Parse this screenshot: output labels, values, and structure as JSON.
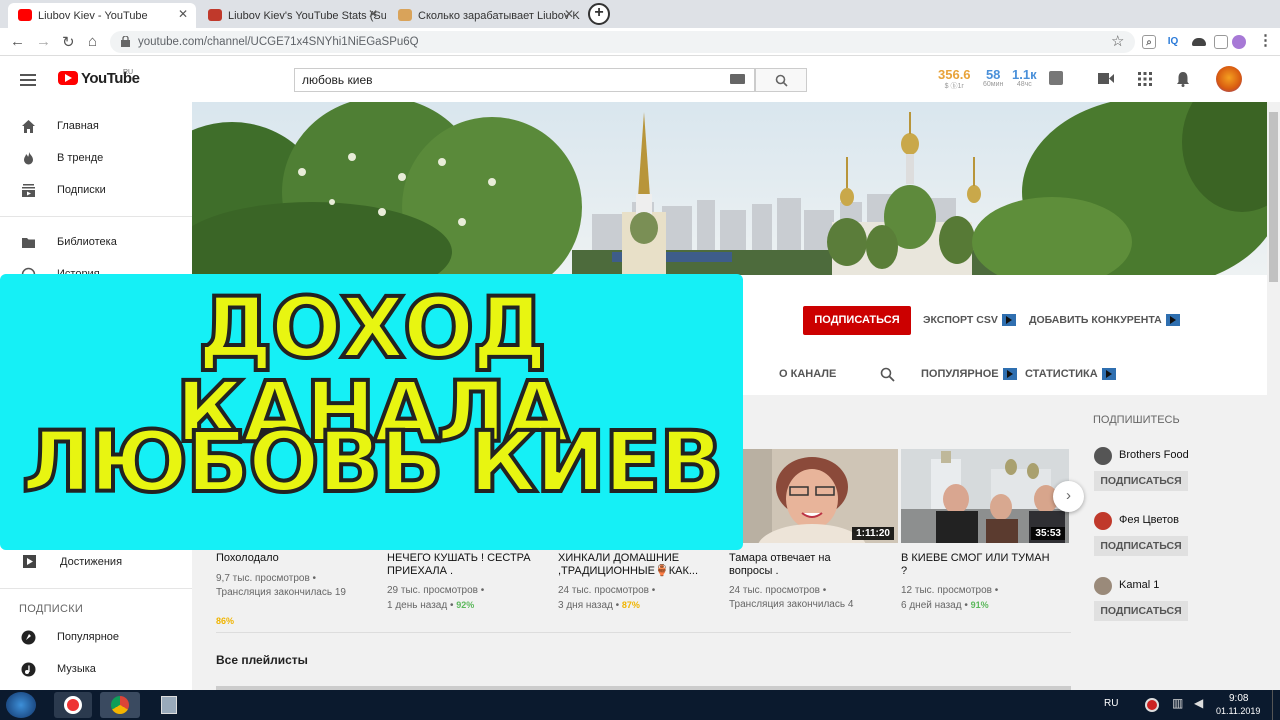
{
  "browser": {
    "tabs": [
      {
        "title": "Liubov Kiev - YouTube"
      },
      {
        "title": "Liubov Kiev's YouTube Stats (Sur"
      },
      {
        "title": "Сколько зарабатывает Liubov K"
      }
    ],
    "url": "youtube.com/channel/UCGE71x4SNYhi1NiEGaSPu6Q",
    "ext_iq": "IQ"
  },
  "header": {
    "logo_text": "YouTube",
    "logo_region": "RU",
    "search_value": "любовь киев",
    "stats": [
      {
        "value": "356.6",
        "sub": "$ ⓑ1г",
        "color": "#e8a33a"
      },
      {
        "value": "58",
        "sub": "60мин",
        "color": "#4a90d9"
      },
      {
        "value": "1.1к",
        "sub": "48чс",
        "color": "#4a90d9"
      }
    ]
  },
  "sidebar": {
    "items": [
      {
        "label": "Главная"
      },
      {
        "label": "В тренде"
      },
      {
        "label": "Подписки"
      },
      {
        "label": "Библиотека"
      },
      {
        "label": "История"
      },
      {
        "label": "Достижения"
      },
      {
        "label": "Популярное"
      },
      {
        "label": "Музыка"
      }
    ],
    "subs_heading": "ПОДПИСКИ"
  },
  "channel": {
    "subscribe": "ПОДПИСАТЬСЯ",
    "export_csv": "ЭКСПОРТ CSV",
    "add_competitor": "ДОБАВИТЬ КОНКУРЕНТА",
    "tabs": {
      "about": "О КАНАЛЕ",
      "popular": "ПОПУЛЯРНОЕ",
      "stats": "СТАТИСТИКА"
    }
  },
  "videos": [
    {
      "title1": "Похолодало",
      "title2": "",
      "views": "9,7 тыс. просмотров •",
      "when": "Трансляция закончилась 19",
      "pct": "86%"
    },
    {
      "title1": "НЕЧЕГО КУШАТЬ ! СЕСТРА",
      "title2": "ПРИЕХАЛА .",
      "views": "29 тыс. просмотров •",
      "when": "1 день назад •",
      "pct": "92%"
    },
    {
      "title1": "ХИНКАЛИ ДОМАШНИЕ",
      "title2": ",ТРАДИЦИОННЫЕ🏺КАК...",
      "views": "24 тыс. просмотров •",
      "when": "3 дня назад •",
      "pct": "87%"
    },
    {
      "title1": "Тамара отвечает на",
      "title2": "вопросы .",
      "views": "24 тыс. просмотров •",
      "when": "Трансляция закончилась 4",
      "duration": "1:11:20"
    },
    {
      "title1": "В КИЕВЕ СМОГ ИЛИ ТУМАН",
      "title2": "?",
      "views": "12 тыс. просмотров •",
      "when": "6 дней назад •",
      "pct": "91%",
      "duration": "35:53"
    }
  ],
  "playlists_heading": "Все плейлисты",
  "subscribe_panel": {
    "heading": "ПОДПИШИТЕСЬ",
    "channels": [
      {
        "name": "Brothers Food",
        "button": "ПОДПИСАТЬСЯ"
      },
      {
        "name": "Фея Цветов",
        "button": "ПОДПИСАТЬСЯ"
      },
      {
        "name": "Kamal 1",
        "button": "ПОДПИСАТЬСЯ"
      }
    ]
  },
  "overlay": {
    "line1": "ДОХОД КАНАЛА",
    "line2": "ЛЮБОВЬ КИЕВ"
  },
  "taskbar": {
    "lang": "RU",
    "time": "9:08",
    "date": "01.11.2019"
  }
}
